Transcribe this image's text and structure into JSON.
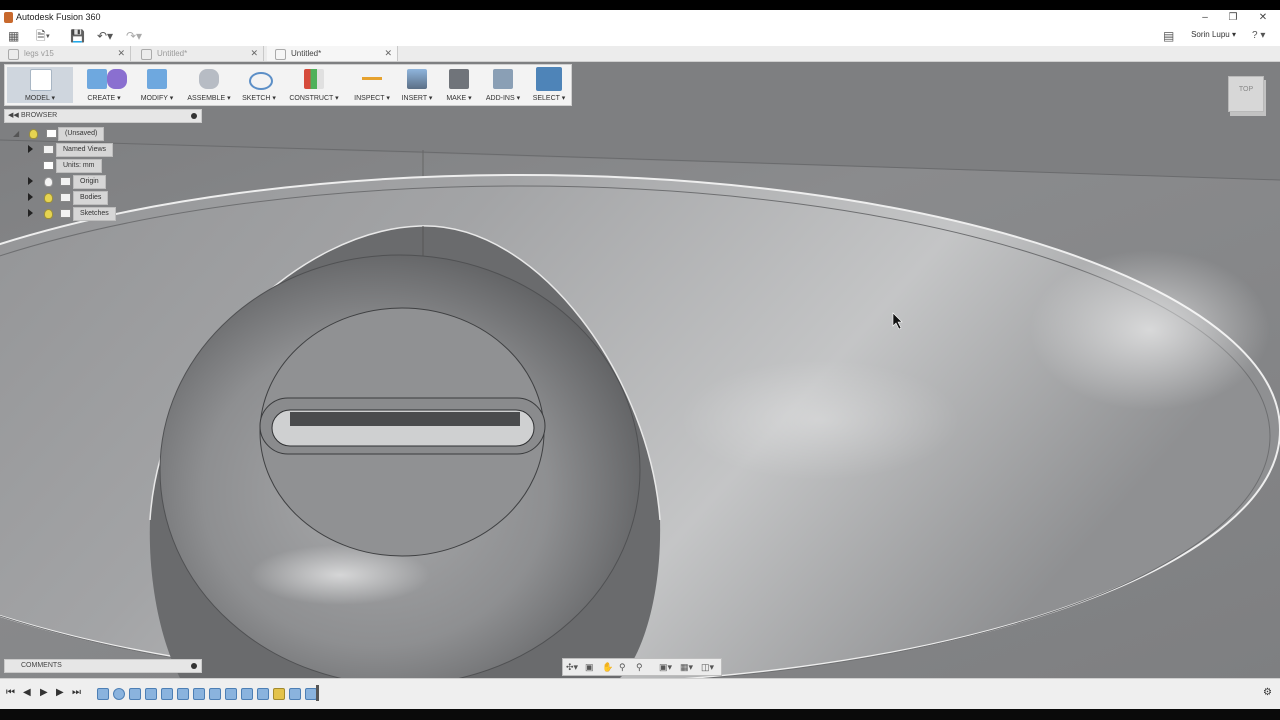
{
  "window": {
    "title": "Autodesk Fusion 360",
    "minimize_icon": "minimize-icon",
    "restore_icon": "restore-icon",
    "close_icon": "close-icon"
  },
  "app_toolbar": {
    "user": "Sorin Lupu ▾",
    "help": "? ▾"
  },
  "tabs": [
    {
      "label": "legs v15",
      "active": false
    },
    {
      "label": "Untitled*",
      "active": false
    },
    {
      "label": "Untitled*",
      "active": true
    }
  ],
  "ribbon": {
    "model": "MODEL ▾",
    "create": "CREATE ▾",
    "modify": "MODIFY ▾",
    "assemble": "ASSEMBLE ▾",
    "sketch": "SKETCH ▾",
    "construct": "CONSTRUCT ▾",
    "inspect": "INSPECT ▾",
    "insert": "INSERT ▾",
    "make": "MAKE ▾",
    "addins": "ADD-INS ▾",
    "select": "SELECT ▾"
  },
  "browser": {
    "title": "BROWSER",
    "root": "(Unsaved)",
    "items": [
      "Named Views",
      "Units: mm",
      "Origin",
      "Bodies",
      "Sketches"
    ]
  },
  "comments": {
    "title": "COMMENTS"
  },
  "viewcube": {
    "face": "TOP"
  },
  "colors": {
    "viewport": "#838486",
    "ribbon_bg": "#f3f3f3",
    "highlight": "#4e84b8",
    "bulb": "#e6d451"
  }
}
